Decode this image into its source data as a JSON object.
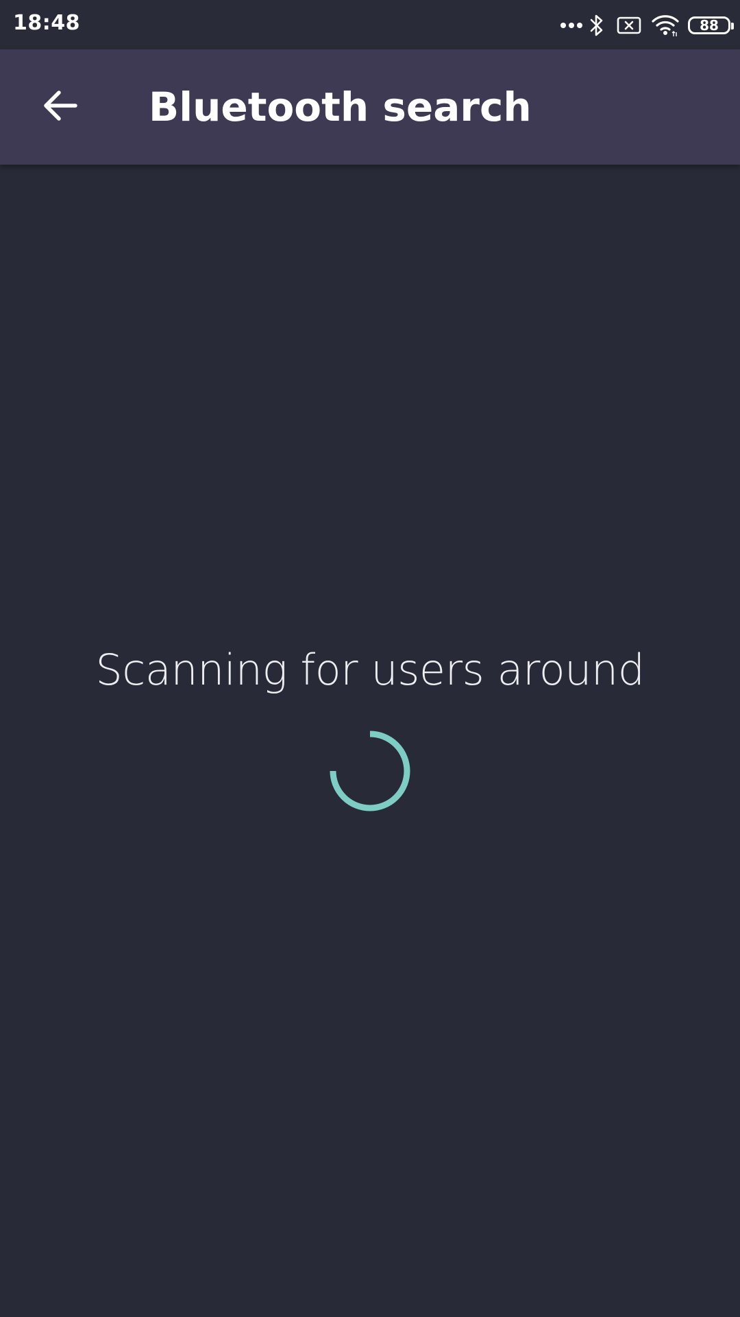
{
  "status_bar": {
    "time": "18:48",
    "icons": [
      "more-dots-icon",
      "bluetooth-icon",
      "no-sim-icon",
      "wifi-icon",
      "battery-icon"
    ],
    "battery_level": "88"
  },
  "app_bar": {
    "title": "Bluetooth search",
    "back_icon": "arrow-left-icon"
  },
  "content": {
    "scan_message": "Scanning for users around",
    "spinner_color": "#7ecdc4"
  },
  "colors": {
    "background": "#282a37",
    "app_bar": "#3e3a53",
    "accent": "#7ecdc4"
  }
}
